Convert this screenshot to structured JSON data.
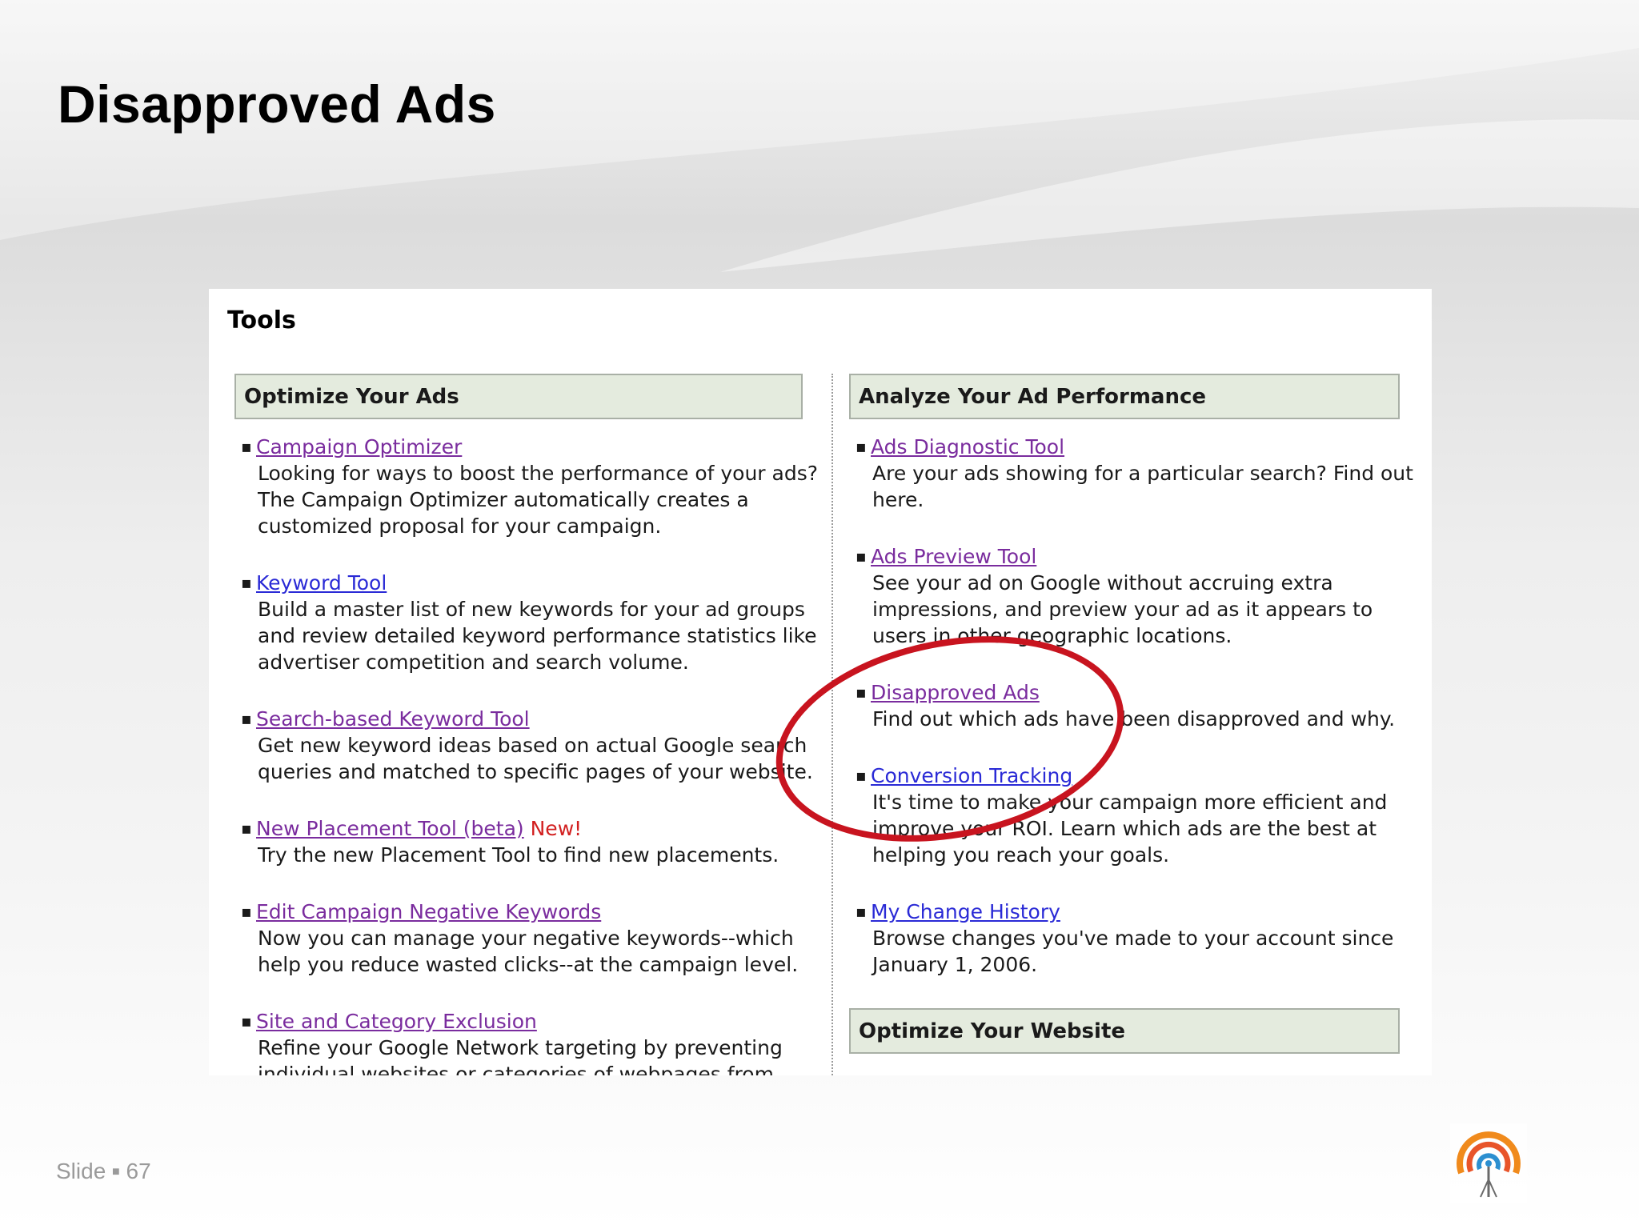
{
  "slide": {
    "title": "Disapproved Ads",
    "footer_label": "Slide",
    "footer_sep": "■",
    "footer_number": "67"
  },
  "screenshot": {
    "heading": "Tools",
    "left_column": {
      "header": "Optimize Your Ads",
      "items": [
        {
          "link": "Campaign Optimizer",
          "visited": true,
          "desc": [
            "Looking for ways to boost the performance of your ads?",
            "The Campaign Optimizer automatically creates a",
            "customized proposal for your campaign."
          ]
        },
        {
          "link": "Keyword Tool",
          "visited": false,
          "desc": [
            "Build a master list of new keywords for your ad groups",
            "and review detailed keyword performance statistics like",
            "advertiser competition and search volume."
          ]
        },
        {
          "link": "Search-based Keyword Tool",
          "visited": true,
          "desc": [
            "Get new keyword ideas based on actual Google search",
            "queries and matched to specific pages of your website."
          ]
        },
        {
          "link": "New Placement Tool (beta)",
          "visited": true,
          "badge": "New!",
          "desc": [
            "Try the new Placement Tool to find new placements."
          ]
        },
        {
          "link": "Edit Campaign Negative Keywords",
          "visited": true,
          "desc": [
            "Now you can manage your negative keywords--which",
            "help you reduce wasted clicks--at the campaign level."
          ]
        },
        {
          "link": "Site and Category Exclusion",
          "visited": true,
          "desc": [
            "Refine your Google Network targeting by preventing",
            "individual websites or categories of webpages from"
          ]
        }
      ]
    },
    "right_column": {
      "header": "Analyze Your Ad Performance",
      "items": [
        {
          "link": "Ads Diagnostic Tool",
          "visited": true,
          "desc": [
            "Are your ads showing for a particular search? Find out",
            "here."
          ]
        },
        {
          "link": "Ads Preview Tool",
          "visited": true,
          "desc": [
            "See your ad on Google without accruing extra",
            "impressions, and preview your ad as it appears to",
            "users in other geographic locations."
          ]
        },
        {
          "link": "Disapproved Ads",
          "visited": true,
          "desc": [
            "Find out which ads have been disapproved and why."
          ]
        },
        {
          "link": "Conversion Tracking",
          "visited": false,
          "desc": [
            "It's time to make your campaign more efficient and",
            "improve your ROI. Learn which ads are the best at",
            "helping you reach your goals."
          ]
        },
        {
          "link": "My Change History",
          "visited": false,
          "desc": [
            "Browse changes you've made to your account since",
            "January 1, 2006."
          ]
        }
      ],
      "second_header": "Optimize Your Website"
    }
  },
  "colors": {
    "link": "#2a2ad6",
    "visited_link": "#7a2c9e",
    "new_badge": "#d21f1f",
    "highlight_circle": "#c8141f",
    "section_header_bg": "#e4ebde"
  },
  "icons": {
    "logo": "broadcast-tower-logo-icon",
    "highlight": "red-hand-drawn-circle"
  }
}
